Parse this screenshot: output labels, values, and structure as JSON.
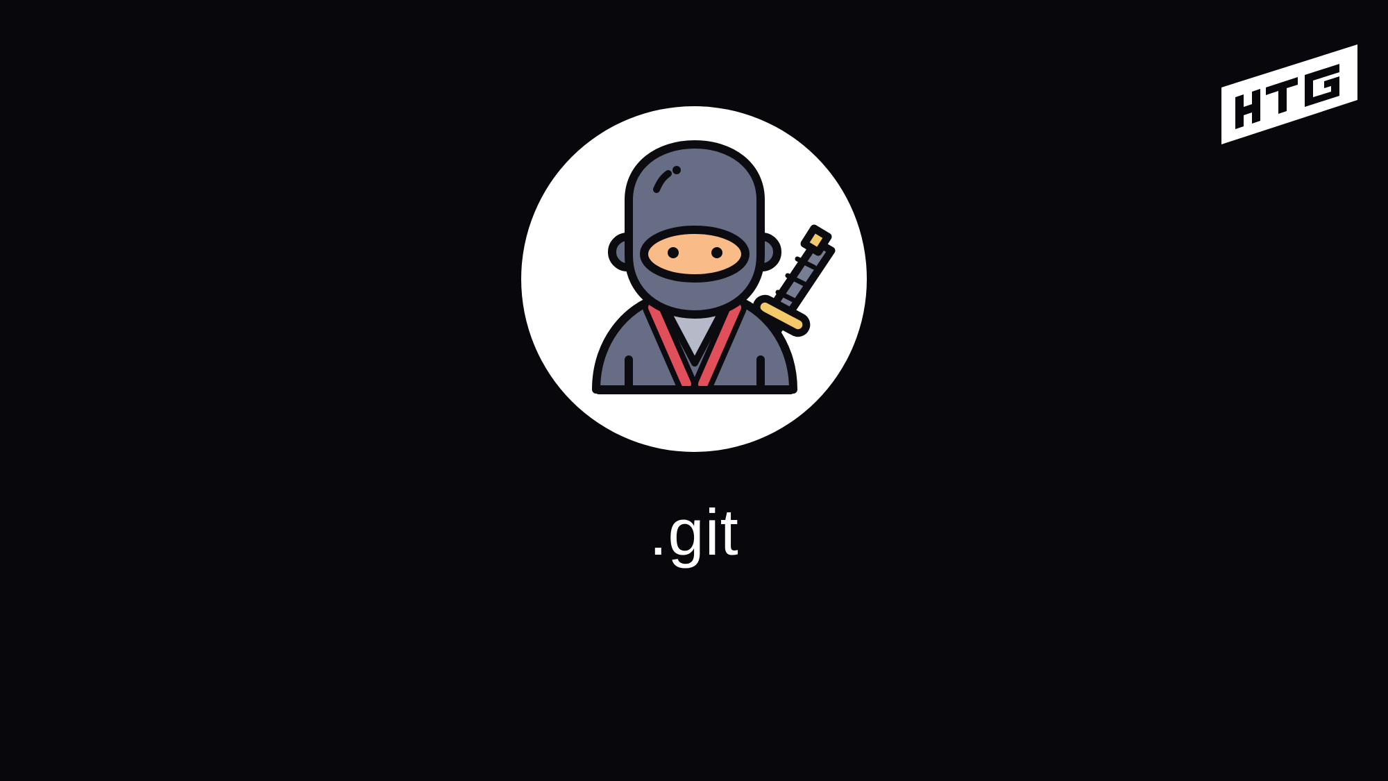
{
  "profile": {
    "name": ".git",
    "avatar_icon": "ninja-icon"
  },
  "brand": {
    "logo_icon": "htg-logo-icon",
    "logo_text": "HTG"
  },
  "colors": {
    "background": "#08070b",
    "circle": "#ffffff",
    "hood": "#666d84",
    "face": "#f9bb87",
    "collar": "#e04f5a",
    "shirt": "#b6b9c7",
    "sword_wrap": "#f4c96a",
    "outline": "#0c0c10"
  }
}
